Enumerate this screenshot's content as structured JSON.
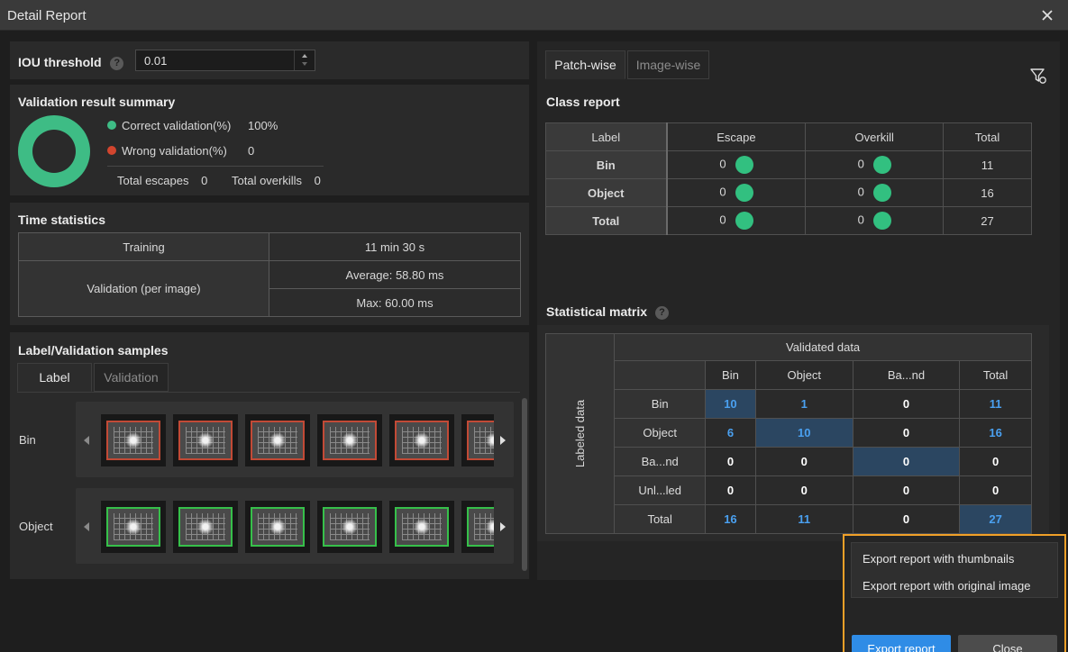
{
  "window": {
    "title": "Detail Report"
  },
  "iou": {
    "label": "IOU threshold",
    "help": "?",
    "value": "0.01"
  },
  "summary": {
    "title": "Validation result summary",
    "correct_label": "Correct validation(%)",
    "correct_value": "100%",
    "wrong_label": "Wrong validation(%)",
    "wrong_value": "0",
    "escapes_label": "Total escapes",
    "escapes_value": "0",
    "overkills_label": "Total overkills",
    "overkills_value": "0",
    "correct_fraction": 1.0,
    "colors": {
      "correct": "#3ebc85",
      "wrong": "#d2452e"
    }
  },
  "time": {
    "title": "Time statistics",
    "training_label": "Training",
    "training_value": "11 min 30 s",
    "validation_label": "Validation (per image)",
    "average": "Average: 58.80 ms",
    "max": "Max: 60.00 ms"
  },
  "samples": {
    "title": "Label/Validation samples",
    "tabs": [
      "Label",
      "Validation"
    ],
    "rows": [
      {
        "label": "Bin",
        "outline": "red"
      },
      {
        "label": "Object",
        "outline": "green"
      }
    ]
  },
  "right_tabs": [
    "Patch-wise",
    "Image-wise"
  ],
  "class_report": {
    "title": "Class report",
    "headers": [
      "Label",
      "Escape",
      "Overkill",
      "Total"
    ],
    "rows": [
      {
        "label": "Bin",
        "escape": "0",
        "overkill": "0",
        "total": "11"
      },
      {
        "label": "Object",
        "escape": "0",
        "overkill": "0",
        "total": "16"
      },
      {
        "label": "Total",
        "escape": "0",
        "overkill": "0",
        "total": "27"
      }
    ]
  },
  "matrix": {
    "title": "Statistical matrix",
    "help": "?",
    "validated_label": "Validated data",
    "labeled_label": "Labeled data",
    "columns": [
      "Bin",
      "Object",
      "Ba...nd",
      "Total"
    ],
    "rows": [
      {
        "label": "Bin",
        "values": [
          "10",
          "1",
          "0",
          "11"
        ]
      },
      {
        "label": "Object",
        "values": [
          "6",
          "10",
          "0",
          "16"
        ]
      },
      {
        "label": "Ba...nd",
        "values": [
          "0",
          "0",
          "0",
          "0"
        ]
      },
      {
        "label": "Unl...led",
        "values": [
          "0",
          "0",
          "0",
          "0"
        ]
      },
      {
        "label": "Total",
        "values": [
          "16",
          "11",
          "0",
          "27"
        ]
      }
    ]
  },
  "export": {
    "menu": [
      "Export report with thumbnails",
      "Export report with original image"
    ],
    "export_button": "Export report",
    "close_button": "Close",
    "highlight_color": "#f0a028"
  }
}
